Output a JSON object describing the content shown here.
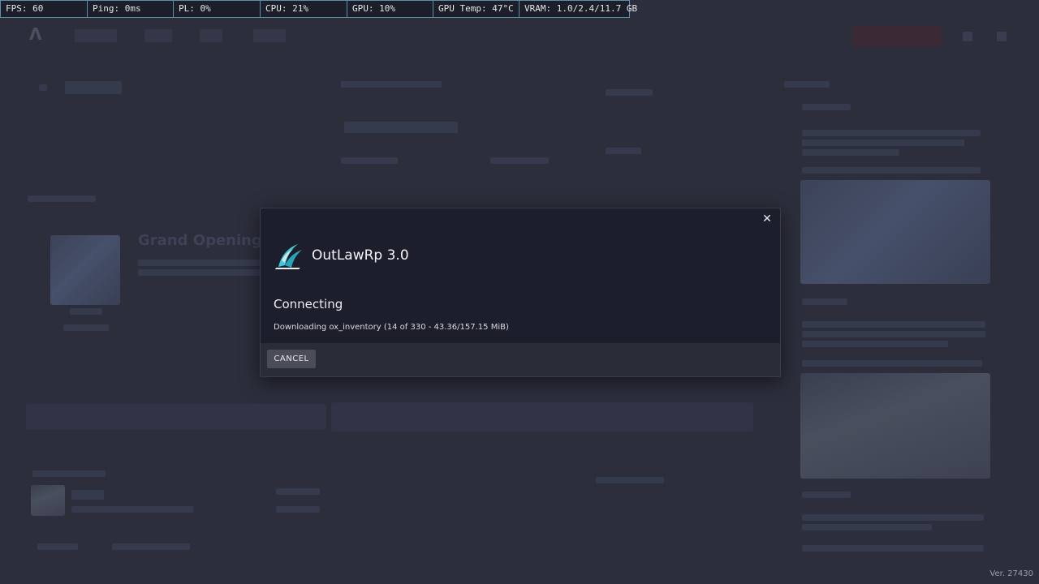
{
  "perf_overlay": {
    "fps": "FPS: 60",
    "ping": "Ping: 0ms",
    "pl": "PL: 0%",
    "cpu": "CPU: 21%",
    "gpu": "GPU: 10%",
    "gpu_temp": "GPU Temp: 47°C",
    "vram": "VRAM: 1.0/2.4/11.7 GB"
  },
  "background": {
    "heading_left": "Grand Opening!!"
  },
  "modal": {
    "server_name": "OutLawRp 3.0",
    "status_title": "Connecting",
    "status_detail": "Downloading ox_inventory (14 of 330 - 43.36/157.15 MiB)",
    "cancel_label": "CANCEL",
    "close_icon": "close-icon",
    "logo_icon": "server-logo-icon"
  },
  "version": "Ver. 27430",
  "colors": {
    "overlay_border": "#5b8fae",
    "modal_bg": "#1d1e2b",
    "footer_bg": "#2a2c38",
    "cancel_bg": "#4a4c58",
    "logo_accent": "#3fc9d6"
  }
}
